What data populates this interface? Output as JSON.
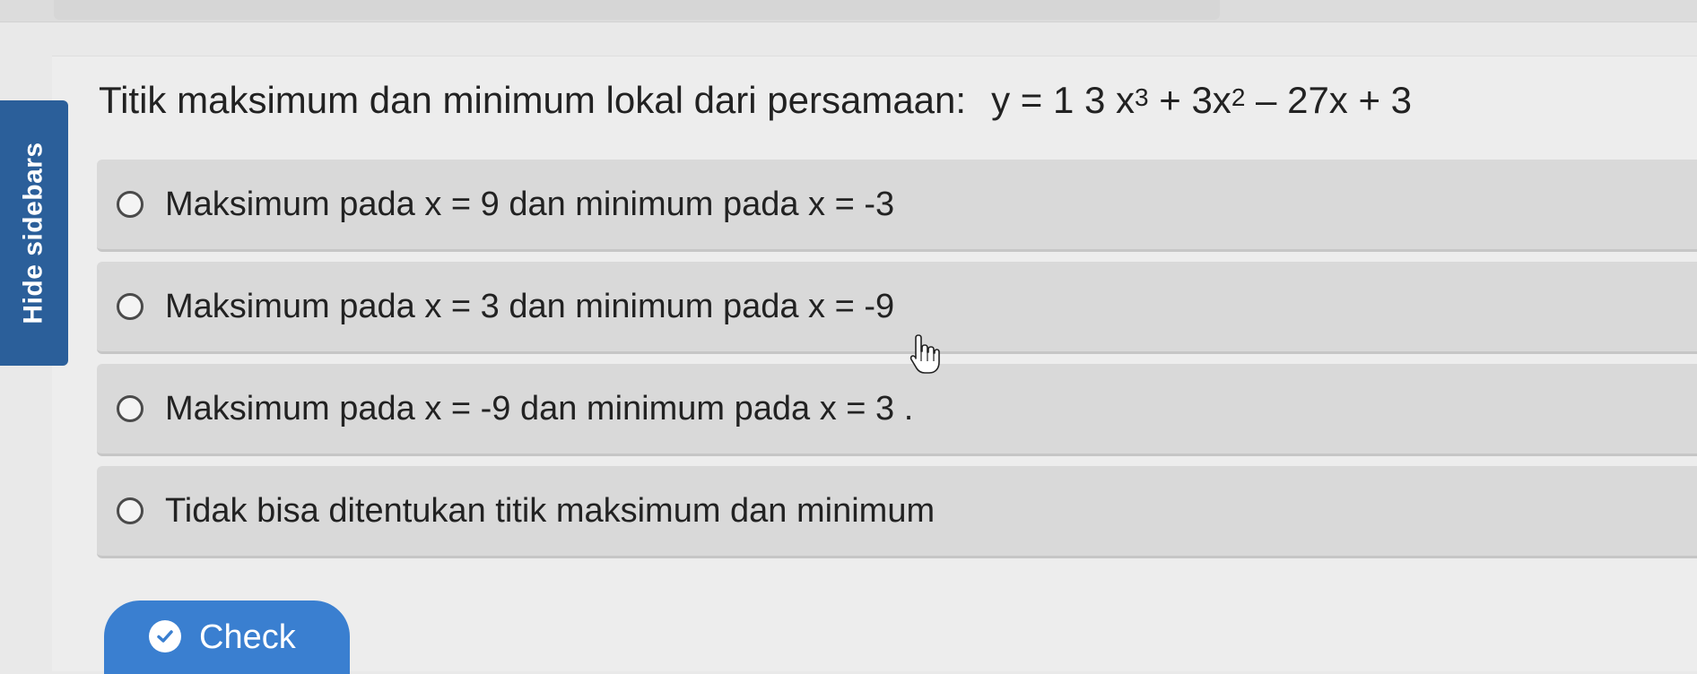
{
  "sidebar_toggle": {
    "label": "Hide sidebars"
  },
  "question": {
    "prefix": "Titik maksimum dan minimum lokal dari persamaan:",
    "equation": {
      "part1": "y = 1 3  x",
      "exp1": "3",
      "part2": " + 3x",
      "exp2": "2",
      "part3": " – 27x + 3"
    }
  },
  "options": [
    {
      "label": "Maksimum pada x = 9 dan minimum pada x = -3",
      "selected": false
    },
    {
      "label": "Maksimum pada x = 3 dan minimum pada x = -9",
      "selected": false
    },
    {
      "label": "Maksimum pada x = -9 dan minimum pada x = 3 .",
      "selected": false
    },
    {
      "label": "Tidak bisa ditentukan titik maksimum dan minimum",
      "selected": false
    }
  ],
  "check_button": {
    "label": "Check"
  },
  "colors": {
    "sidebar_toggle_bg": "#2b5f9a",
    "check_button_bg": "#3a7fd0",
    "option_bg": "#d9d9d9"
  },
  "icons": {
    "check": "check-circle-icon",
    "cursor": "hand-pointer-icon"
  }
}
